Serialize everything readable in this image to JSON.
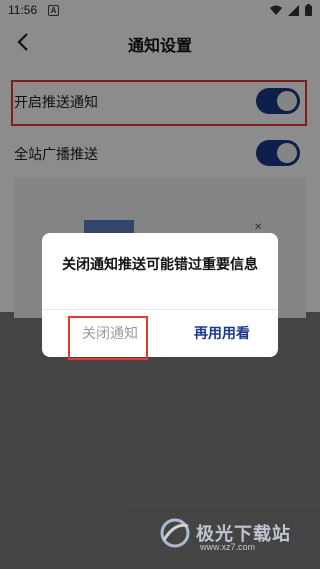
{
  "status_bar": {
    "time": "11:56",
    "notification_icon_letter": "A",
    "icons": [
      "wifi-icon",
      "signal-icon",
      "battery-icon"
    ]
  },
  "header": {
    "title": "通知设置",
    "back_icon": "chevron-left-icon"
  },
  "settings": {
    "items": [
      {
        "label": "开启推送通知",
        "enabled": true
      },
      {
        "label": "全站广播推送",
        "enabled": true
      }
    ],
    "toggle_on_color": "#1d3a8a"
  },
  "dialog": {
    "message": "关闭通知推送可能错过重要信息",
    "cancel_label": "关闭通知",
    "confirm_label": "再用用看"
  },
  "watermark": {
    "text": "极光下载站",
    "url": "www.xz7.com"
  },
  "colors": {
    "accent": "#1d3a8a",
    "highlight_border": "#e53935"
  }
}
